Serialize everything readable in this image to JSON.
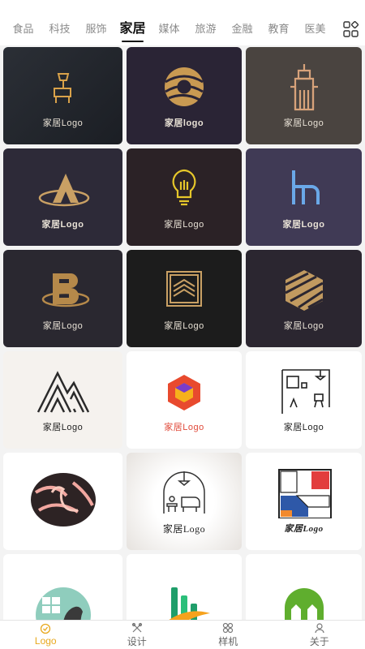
{
  "tabs": [
    {
      "label": "食品",
      "active": false
    },
    {
      "label": "科技",
      "active": false
    },
    {
      "label": "服饰",
      "active": false
    },
    {
      "label": "家居",
      "active": true
    },
    {
      "label": "媒体",
      "active": false
    },
    {
      "label": "旅游",
      "active": false
    },
    {
      "label": "金融",
      "active": false
    },
    {
      "label": "教育",
      "active": false
    },
    {
      "label": "医美",
      "active": false
    }
  ],
  "grid_icon": "grid-category-icon",
  "cards": [
    {
      "label": "家居Logo",
      "icon": "lamp-desk-icon"
    },
    {
      "label": "家居logo",
      "icon": "woven-sphere-icon"
    },
    {
      "label": "家居Logo",
      "icon": "building-tower-icon"
    },
    {
      "label": "家居Logo",
      "icon": "letter-a-orbit-icon"
    },
    {
      "label": "家居Logo",
      "icon": "lightbulb-icon"
    },
    {
      "label": "家居Logo",
      "icon": "letter-h-chair-icon"
    },
    {
      "label": "家居Logo",
      "icon": "letter-b-orbit-icon"
    },
    {
      "label": "家居Logo",
      "icon": "house-frame-icon"
    },
    {
      "label": "家居Logo",
      "icon": "striped-hexagon-icon"
    },
    {
      "label": "家居Logo",
      "icon": "mountain-lines-icon"
    },
    {
      "label": "家居Logo",
      "icon": "hexagon-cube-icon"
    },
    {
      "label": "家居Logo",
      "icon": "room-interior-icon"
    },
    {
      "label": "",
      "icon": "flamingo-circle-icon"
    },
    {
      "label": "家居Logo",
      "icon": "living-room-icon"
    },
    {
      "label": "家居Logo",
      "icon": "color-block-room-icon"
    },
    {
      "label": "",
      "icon": "chair-window-icon"
    },
    {
      "label": "",
      "icon": "green-bars-swoosh-icon"
    },
    {
      "label": "",
      "icon": "green-house-swoosh-icon"
    }
  ],
  "nav": [
    {
      "label": "Logo",
      "icon": "logo-icon",
      "active": true
    },
    {
      "label": "设计",
      "icon": "design-icon",
      "active": false
    },
    {
      "label": "样机",
      "icon": "mockup-icon",
      "active": false
    },
    {
      "label": "关于",
      "icon": "about-icon",
      "active": false
    }
  ],
  "colors": {
    "accent": "#e8a81e",
    "gold": "#c9a064",
    "active_tab": "#111111"
  }
}
